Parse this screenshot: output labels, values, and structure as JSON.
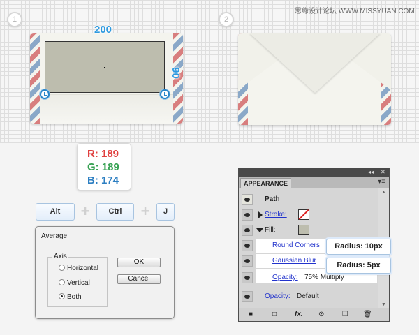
{
  "steps": [
    "1",
    "2"
  ],
  "watermark": "思缘设计论坛 WWW.MISSYUAN.COM",
  "dimensions": {
    "width": "200",
    "height": "90"
  },
  "color": {
    "r": "R: 189",
    "g": "G: 189",
    "b": "B: 174",
    "swatch": "#bdbdae"
  },
  "shortcut": {
    "keys": [
      "Alt",
      "Ctrl",
      "J"
    ],
    "plus": "+"
  },
  "average_dialog": {
    "title": "Average",
    "axis_label": "Axis",
    "options": [
      "Horizontal",
      "Vertical",
      "Both"
    ],
    "selected": "Both",
    "ok": "OK",
    "cancel": "Cancel"
  },
  "appearance": {
    "tab": "APPEARANCE",
    "topbar_collapse": "◂◂",
    "topbar_close": "✕",
    "menu": "▾≡",
    "path_label": "Path",
    "stroke_label": "Stroke:",
    "fill_label": "Fill:",
    "effects": [
      "Round Corners",
      "Gaussian Blur"
    ],
    "opacity_label": "Opacity:",
    "opacity_value": "75% Multiply",
    "bottom_opacity_label": "Opacity:",
    "bottom_opacity_value": "Default",
    "footer_icons": [
      "■",
      "□",
      "fx.",
      "⊘",
      "❐",
      "🗑"
    ]
  },
  "callouts": [
    "Radius: 10px",
    "Radius: 5px"
  ],
  "icons": [
    "step-number-icon",
    "corner-widget-icon",
    "plus-icon",
    "eye-icon",
    "stroke-none-icon",
    "fill-swatch-icon",
    "panel-menu-icon",
    "collapse-icon",
    "close-icon",
    "trash-icon",
    "fx-icon"
  ]
}
